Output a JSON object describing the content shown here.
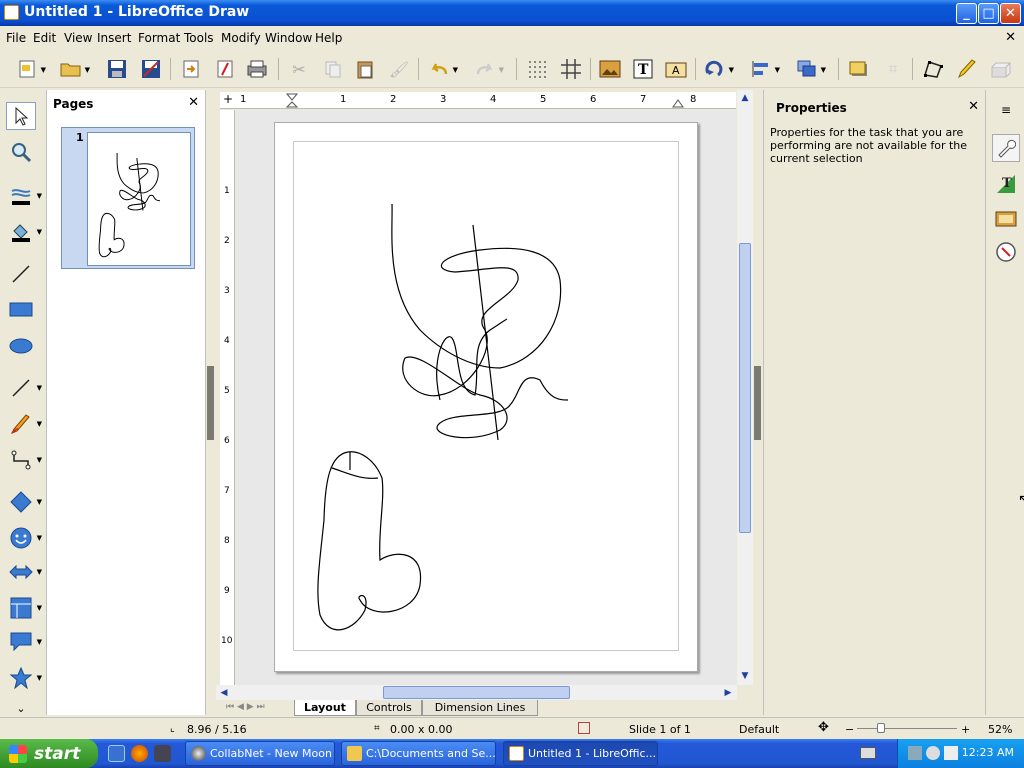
{
  "window": {
    "title": "Untitled 1 - LibreOffice Draw",
    "min": "_",
    "max": "□",
    "close": "✕"
  },
  "menu": [
    "File",
    "Edit",
    "View",
    "Insert",
    "Format",
    "Tools",
    "Modify",
    "Window",
    "Help"
  ],
  "menu_close": "✕",
  "pages_panel": {
    "title": "Pages",
    "close": "✕",
    "thumb_number": "1"
  },
  "ruler": {
    "h": [
      "1",
      "1",
      "2",
      "3",
      "4",
      "5",
      "6",
      "7",
      "8"
    ],
    "v": [
      "1",
      "2",
      "3",
      "4",
      "5",
      "6",
      "7",
      "8",
      "9",
      "10"
    ]
  },
  "tabs": [
    "Layout",
    "Controls",
    "Dimension Lines"
  ],
  "properties": {
    "title": "Properties",
    "close": "✕",
    "message": "Properties for the task that you are performing are not available for the current selection"
  },
  "status": {
    "position": "8.96 / 5.16",
    "size": "0.00 x 0.00",
    "slide": "Slide 1 of 1",
    "master": "Default",
    "zoom": "52%",
    "zoom_minus": "−",
    "zoom_plus": "+"
  },
  "taskbar": {
    "start": "start",
    "tasks": [
      "CollabNet - New Moon",
      "C:\\Documents and Se...",
      "Untitled 1 - LibreOffic..."
    ],
    "clock": "12:23 AM"
  },
  "colors": {
    "titlebar": "#0a4fd0",
    "taskbar": "#2458d8",
    "start": "#3aa02e",
    "selection": "#c8d8f0"
  }
}
